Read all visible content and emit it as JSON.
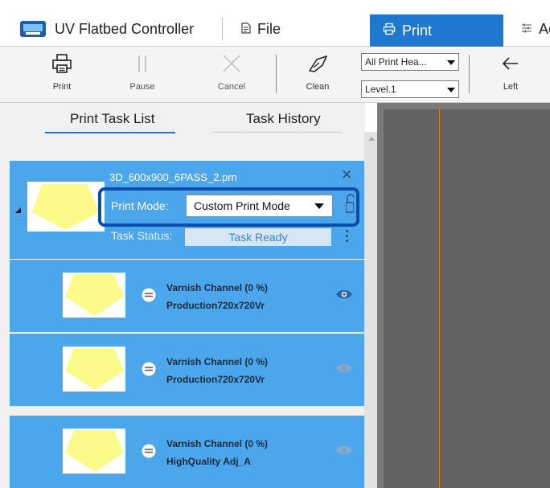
{
  "app": {
    "title": "UV Flatbed Controller",
    "menu_file": "File",
    "menu_print": "Print",
    "menu_advanced": "Ac"
  },
  "toolbar": {
    "print_label": "Print",
    "pause_label": "Pause",
    "cancel_label": "Cancel",
    "clean_label": "Clean",
    "head_select": "All Print Hea...",
    "level_select": "Level.1",
    "left_label": "Left"
  },
  "tabs": {
    "task_list": "Print Task List",
    "task_history": "Task History"
  },
  "task": {
    "file_name": "3D_600x900_6PASS_2.prn",
    "mode_label": "Print Mode:",
    "mode_value": "Custom Print Mode",
    "status_label": "Task Status:",
    "status_value": "Task Ready"
  },
  "channels": [
    {
      "name": "Varnish Channel (0 %)",
      "profile": "Production720x720Vr",
      "visible": true
    },
    {
      "name": "Varnish Channel (0 %)",
      "profile": "Production720x720Vr",
      "visible": false
    },
    {
      "name": "Varnish Channel (0 %)",
      "profile": "HighQuality Adj_A",
      "visible": false
    }
  ],
  "colors": {
    "accent": "#1e78d0",
    "card": "#4ba6ec",
    "highlight": "#0b4dac",
    "thumb_shape": "#fbfb8a",
    "canvas": "#636363",
    "guide_line": "#e07a1f"
  }
}
